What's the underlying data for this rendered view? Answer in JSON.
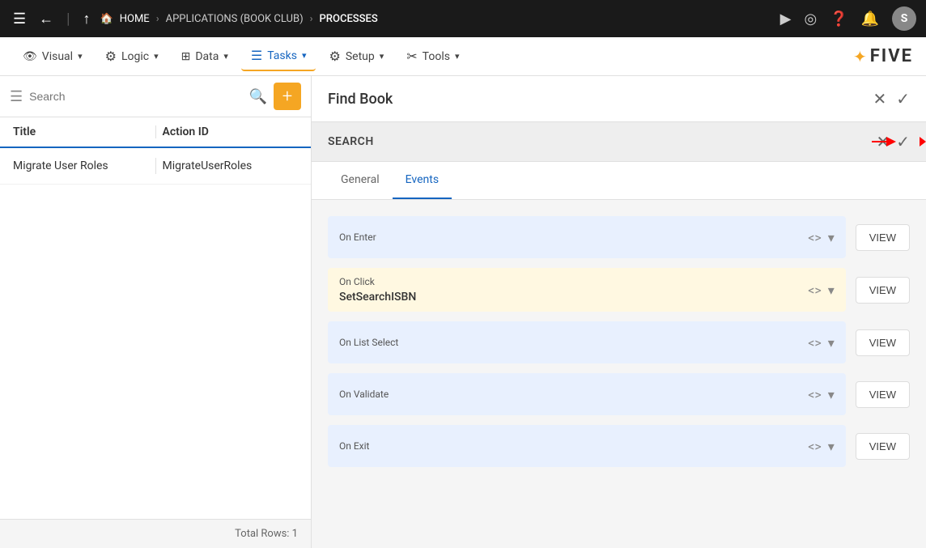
{
  "topNav": {
    "breadcrumbs": [
      "HOME",
      "APPLICATIONS (BOOK CLUB)",
      "PROCESSES"
    ],
    "userInitial": "S"
  },
  "secondaryNav": {
    "items": [
      {
        "id": "visual",
        "label": "Visual",
        "icon": "👁"
      },
      {
        "id": "logic",
        "label": "Logic",
        "icon": "⚙"
      },
      {
        "id": "data",
        "label": "Data",
        "icon": "⊞"
      },
      {
        "id": "tasks",
        "label": "Tasks",
        "icon": "☰",
        "active": true
      },
      {
        "id": "setup",
        "label": "Setup",
        "icon": "⚙"
      },
      {
        "id": "tools",
        "label": "Tools",
        "icon": "✂"
      }
    ],
    "logo": "FIVE"
  },
  "leftPanel": {
    "searchPlaceholder": "Search",
    "columns": {
      "title": "Title",
      "actionId": "Action ID"
    },
    "rows": [
      {
        "title": "Migrate User Roles",
        "actionId": "MigrateUserRoles"
      }
    ],
    "footer": "Total Rows: 1"
  },
  "rightPanel": {
    "title": "Find Book",
    "sectionTitle": "SEARCH",
    "tabs": [
      {
        "id": "general",
        "label": "General"
      },
      {
        "id": "events",
        "label": "Events",
        "active": true
      }
    ],
    "events": [
      {
        "id": "on-enter",
        "label": "On Enter",
        "value": "",
        "hasValue": false
      },
      {
        "id": "on-click",
        "label": "On Click",
        "value": "SetSearchISBN",
        "hasValue": true
      },
      {
        "id": "on-list-select",
        "label": "On List Select",
        "value": "",
        "hasValue": false
      },
      {
        "id": "on-validate",
        "label": "On Validate",
        "value": "",
        "hasValue": false
      },
      {
        "id": "on-exit",
        "label": "On Exit",
        "value": "",
        "hasValue": false
      }
    ],
    "viewButtonLabel": "VIEW"
  }
}
